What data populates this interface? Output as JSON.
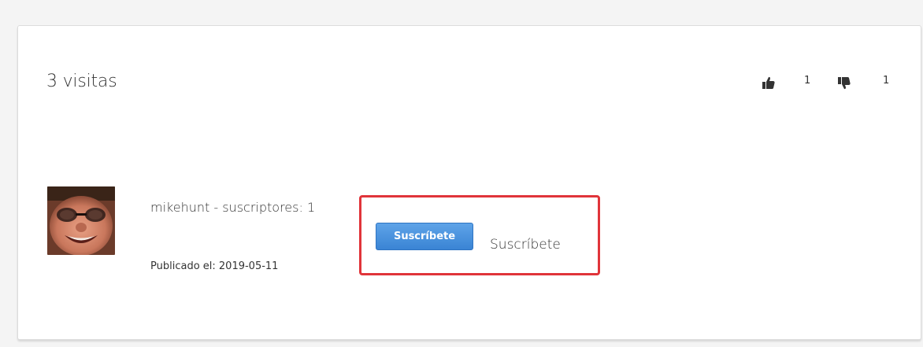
{
  "video_stats": {
    "views_label": "3 visitas",
    "likes": "1",
    "dislikes": "1",
    "like_icon": "thumbs-up-icon",
    "dislike_icon": "thumbs-down-icon"
  },
  "author": {
    "line": "mikehunt - suscriptores: 1",
    "avatar_icon": "user-avatar",
    "published": "Publicado el: 2019-05-11"
  },
  "subscribe": {
    "button_label": "Suscríbete",
    "text_label": "Suscríbete",
    "highlight_color": "#e0343a",
    "button_color": "#4a90e2"
  }
}
